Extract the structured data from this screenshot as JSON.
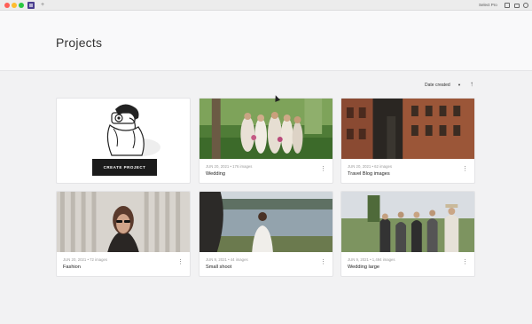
{
  "window": {
    "plus_label": "+",
    "selected_pro": "Select Pro"
  },
  "header": {
    "title": "Projects"
  },
  "sort": {
    "label": "Date created",
    "caret": "▼",
    "arrow": "↑"
  },
  "create": {
    "button_label": "CREATE PROJECT"
  },
  "projects": [
    {
      "meta": "JUN 20, 2021 • 176 images",
      "name": "Wedding"
    },
    {
      "meta": "JUN 20, 2021 • 62 images",
      "name": "Travel Blog images"
    },
    {
      "meta": "JUN 20, 2021 • 72 images",
      "name": "Fashion"
    },
    {
      "meta": "JUN 9, 2021 • 44 images",
      "name": "Small shoot"
    },
    {
      "meta": "JUN 9, 2021 • 1,494 images",
      "name": "Wedding large"
    }
  ],
  "menu_glyph": "⋮"
}
